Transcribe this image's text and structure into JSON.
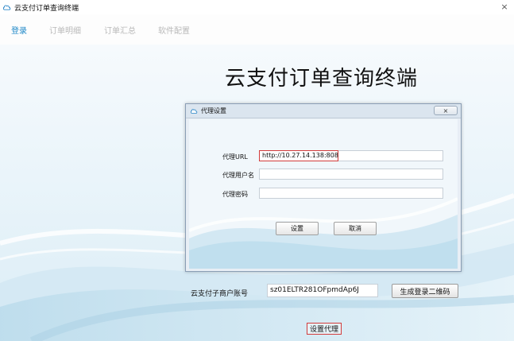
{
  "window": {
    "title": "云支付订单查询终端",
    "close_glyph": "×"
  },
  "tabs": [
    {
      "label": "登录",
      "active": true
    },
    {
      "label": "订单明细",
      "active": false
    },
    {
      "label": "订单汇总",
      "active": false
    },
    {
      "label": "软件配置",
      "active": false
    }
  ],
  "main": {
    "app_title": "云支付订单查询终端",
    "merchant_label": "云支付子商户账号",
    "merchant_value": "sz01ELTR281OFpmdAp6J",
    "qr_button": "生成登录二维码",
    "proxy_link": "设置代理"
  },
  "dialog": {
    "title": "代理设置",
    "close_glyph": "×",
    "fields": [
      {
        "label": "代理URL",
        "value": "http://10.27.14.138:808"
      },
      {
        "label": "代理用户名",
        "value": ""
      },
      {
        "label": "代理密码",
        "value": ""
      }
    ],
    "ok_button": "设置",
    "cancel_button": "取消"
  },
  "colors": {
    "accent": "#1e88c8",
    "tab_inactive": "#b9b9b9",
    "highlight": "#d23b3b",
    "background_wave": "#cfe6f2"
  },
  "icons": {
    "app": "cloud-icon",
    "dialog": "cloud-icon",
    "close": "close-icon"
  }
}
